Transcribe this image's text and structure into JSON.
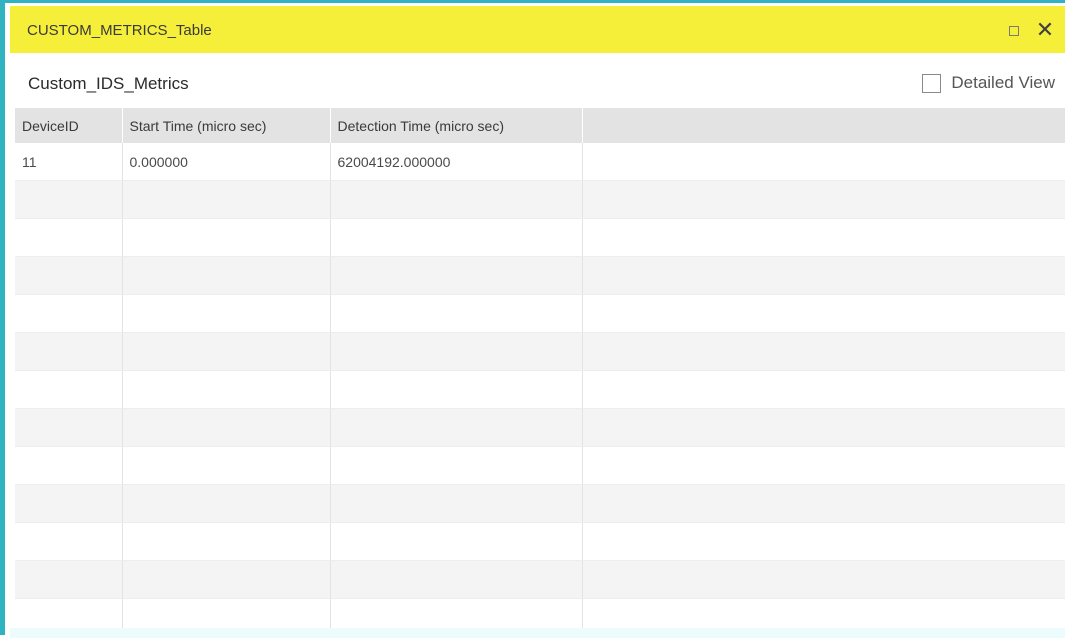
{
  "window": {
    "title": "CUSTOM_METRICS_Table"
  },
  "panel": {
    "title": "Custom_IDS_Metrics",
    "detailed_view_label": "Detailed View",
    "detailed_view_checked": false
  },
  "table": {
    "columns": [
      "DeviceID",
      "Start Time (micro sec)",
      "Detection Time (micro sec)",
      ""
    ],
    "rows": [
      [
        "11",
        "0.000000",
        "62004192.000000",
        ""
      ],
      [
        "",
        "",
        "",
        ""
      ],
      [
        "",
        "",
        "",
        ""
      ],
      [
        "",
        "",
        "",
        ""
      ],
      [
        "",
        "",
        "",
        ""
      ],
      [
        "",
        "",
        "",
        ""
      ],
      [
        "",
        "",
        "",
        ""
      ],
      [
        "",
        "",
        "",
        ""
      ],
      [
        "",
        "",
        "",
        ""
      ],
      [
        "",
        "",
        "",
        ""
      ],
      [
        "",
        "",
        "",
        ""
      ],
      [
        "",
        "",
        "",
        ""
      ],
      [
        "",
        "",
        "",
        ""
      ]
    ]
  },
  "colors": {
    "titlebar": "#f5ef3a",
    "window_border": "#2fb3c0",
    "header_row": "#e3e3e3",
    "alt_row": "#f4f4f4"
  }
}
